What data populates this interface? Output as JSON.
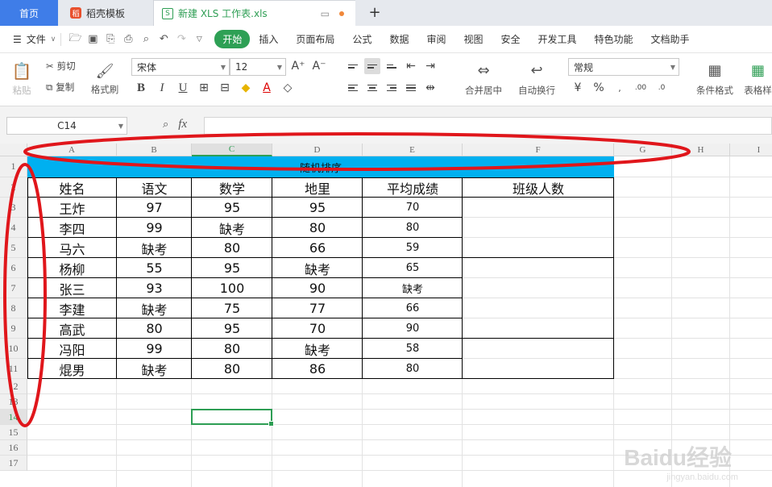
{
  "tabs": {
    "home": "首页",
    "docer": "稻壳模板",
    "file": "新建 XLS 工作表.xls"
  },
  "menu": {
    "file": "文件",
    "tabs": [
      "开始",
      "插入",
      "页面布局",
      "公式",
      "数据",
      "审阅",
      "视图",
      "安全",
      "开发工具",
      "特色功能",
      "文档助手"
    ],
    "active": "开始"
  },
  "ribbon": {
    "paste": "粘贴",
    "cut": "剪切",
    "copy": "复制",
    "format_painter": "格式刷",
    "font_name": "宋体",
    "font_size": "12",
    "merge_center": "合并居中",
    "wrap_text": "自动换行",
    "number_format": "常规",
    "conditional_format": "条件格式",
    "table_style": "表格样"
  },
  "formula_bar": {
    "name_box": "C14",
    "fx": "fx",
    "formula": ""
  },
  "grid": {
    "columns": [
      "A",
      "B",
      "C",
      "D",
      "E",
      "F",
      "G",
      "H",
      "I"
    ],
    "selected_column": "C",
    "rows": [
      "1",
      "2",
      "3",
      "4",
      "5",
      "6",
      "7",
      "8",
      "9",
      "10",
      "11",
      "12",
      "13",
      "14",
      "15",
      "16",
      "17"
    ],
    "selected_row": "14",
    "active_cell": "C14"
  },
  "table": {
    "title": "随机排序",
    "headers": [
      "姓名",
      "语文",
      "数学",
      "地里",
      "平均成绩",
      "班级人数"
    ],
    "rows": [
      [
        "王炸",
        "97",
        "95",
        "95",
        "70"
      ],
      [
        "李四",
        "99",
        "缺考",
        "80",
        "80"
      ],
      [
        "马六",
        "缺考",
        "80",
        "66",
        "59"
      ],
      [
        "杨柳",
        "55",
        "95",
        "缺考",
        "65"
      ],
      [
        "张三",
        "93",
        "100",
        "90",
        "缺考"
      ],
      [
        "李建",
        "缺考",
        "75",
        "77",
        "66"
      ],
      [
        "高武",
        "80",
        "95",
        "70",
        "90"
      ],
      [
        "冯阳",
        "99",
        "80",
        "缺考",
        "58"
      ],
      [
        "焜男",
        "缺考",
        "80",
        "86",
        "80"
      ]
    ]
  },
  "watermark": {
    "main": "Baidu经验",
    "sub": "jingyan.baidu.com"
  },
  "colors": {
    "title_band": "#00b0f0",
    "accent_green": "#2e9e54",
    "annotation_red": "#e0161b"
  }
}
